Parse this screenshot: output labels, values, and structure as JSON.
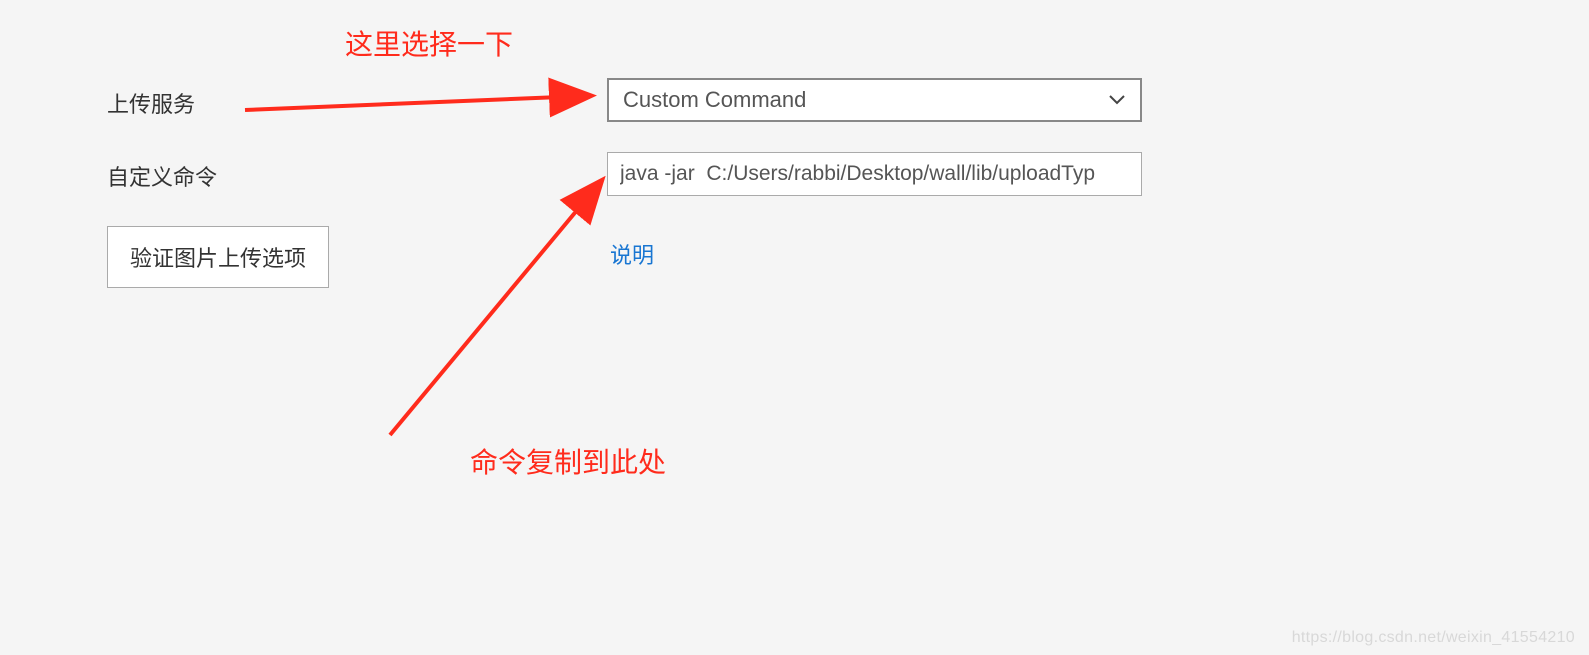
{
  "annotations": {
    "top": "这里选择一下",
    "bottom": "命令复制到此处"
  },
  "form": {
    "upload_label": "上传服务",
    "custom_label": "自定义命令",
    "select_value": "Custom Command",
    "command_value": "java -jar  C:/Users/rabbi/Desktop/wall/lib/uploadTyp",
    "verify_button": "验证图片上传选项",
    "desc_link": "说明"
  },
  "watermark": "https://blog.csdn.net/weixin_41554210",
  "colors": {
    "annotation": "#ff2b1c",
    "link": "#1976d2"
  }
}
